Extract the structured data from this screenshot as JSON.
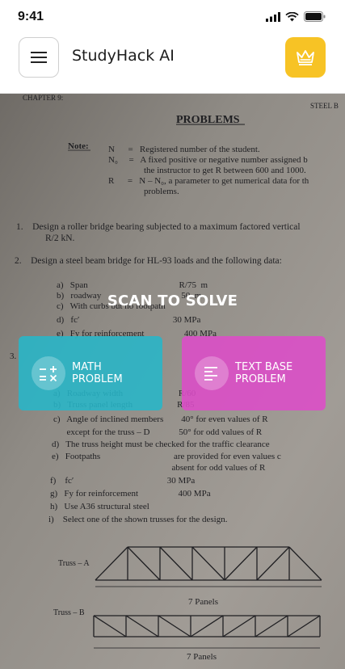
{
  "status": {
    "time": "9:41"
  },
  "header": {
    "title": "StudyHack AI",
    "menu_icon": "hamburger-icon",
    "premium_icon": "crown-icon"
  },
  "camera": {
    "document": {
      "chapter": "CHAPTER 9:",
      "right_header": "STEEL B",
      "heading": "PROBLEMS",
      "note_label": "Note:",
      "note_lines": [
        "N      =   Registered number of the student.",
        "N₀     =   A fixed positive or negative number assigned b",
        "                the instructor to get R between 600 and 1000.",
        "R      =   N – N₀, a parameter to get numerical data for th",
        "                problems."
      ],
      "problem1": "1.    Design a roller bridge bearing subjected to a maximum factored vertical",
      "problem1_cont": "R/2 kN.",
      "problem2": "2.    Design a steel beam bridge for HL-93 loads and the following data:",
      "list_a": [
        "a)   Span                                         R/75  m",
        "b)   roadway                                    50  m",
        "c)   With curbs but no footpath",
        "d)   fc′                                          30 MPa",
        "e)   Fy for reinforcement                  400 MPa"
      ],
      "problem3": "3.",
      "list_b": [
        "a)   Roadway width                         R/60",
        "b)   Truss panel length                    R/85",
        "c)   Angle of inclined members        40° for even values of R",
        "      except for the truss – D             50° for odd values of R",
        "d)   The truss height must be checked for the traffic clearance",
        "e)   Footpaths                                 are provided for even values c",
        "                                                      absent for odd values of R",
        "f)    fc′                                          30 MPa",
        "g)   Fy for reinforcement                  400 MPa",
        "h)   Use A36 structural steel",
        "i)    Select one of the shown trusses for the design."
      ],
      "truss_a_label": "Truss – A",
      "truss_a_panels": "7 Panels",
      "truss_b_label": "Truss – B",
      "truss_b_panels": "7 Panels"
    },
    "scan_title": "SCAN TO SOLVE",
    "modes": [
      {
        "label_line1": "MATH",
        "label_line2": "PROBLEM",
        "icon": "math-operators-icon",
        "color": "#27b6c8"
      },
      {
        "label_line1": "TEXT BASE",
        "label_line2": "PROBLEM",
        "icon": "text-lines-icon",
        "color": "#dd4cc8"
      }
    ]
  }
}
